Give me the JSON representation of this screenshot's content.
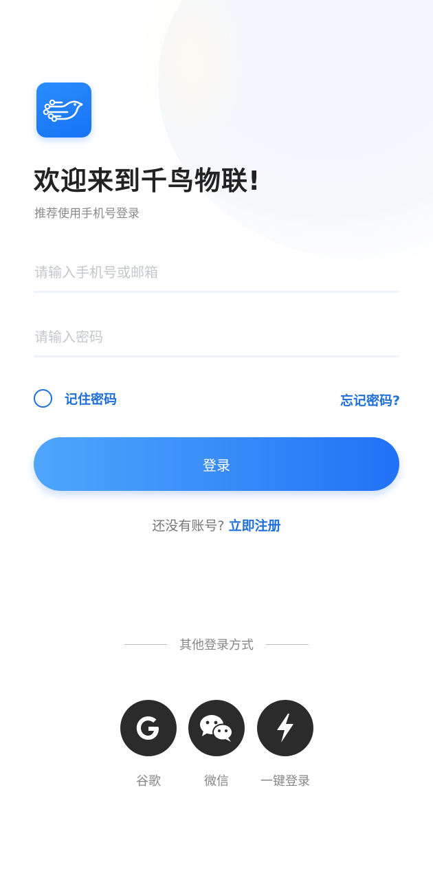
{
  "app": {
    "welcome_title": "欢迎来到千鸟物联!",
    "subtitle": "推荐使用手机号登录",
    "logo_icon": "bird-circuit-logo-icon",
    "brand_color": "#1673f2"
  },
  "form": {
    "phone_placeholder": "请输入手机号或邮箱",
    "phone_value": "",
    "password_placeholder": "请输入密码",
    "password_value": "",
    "remember_label": "记住密码",
    "remember_checked": false,
    "forgot_label": "忘记密码?",
    "login_label": "登录"
  },
  "register": {
    "question": "还没有账号?",
    "link": "立即注册"
  },
  "other_login": {
    "label": "其他登录方式",
    "options": [
      {
        "label": "谷歌",
        "icon": "google-icon"
      },
      {
        "label": "微信",
        "icon": "wechat-icon"
      },
      {
        "label": "一键登录",
        "icon": "lightning-icon"
      }
    ]
  }
}
